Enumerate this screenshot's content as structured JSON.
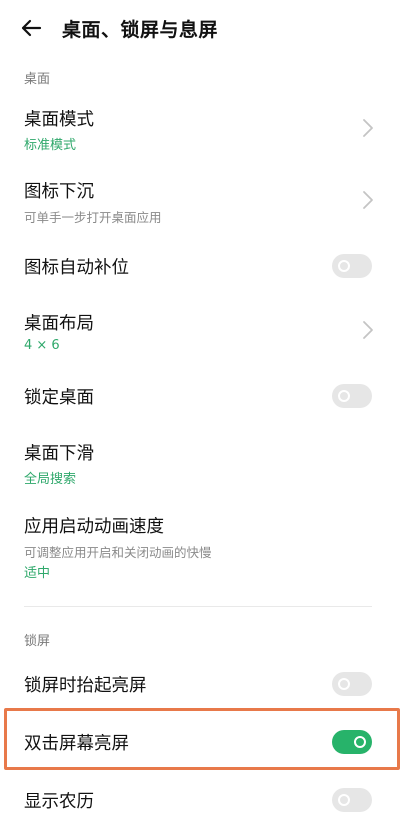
{
  "header": {
    "title": "桌面、锁屏与息屏"
  },
  "sections": {
    "desktop": "桌面",
    "lockscreen": "锁屏"
  },
  "items": {
    "desktop_mode": {
      "title": "桌面模式",
      "value": "标准模式"
    },
    "icon_sink": {
      "title": "图标下沉",
      "subtitle": "可单手一步打开桌面应用"
    },
    "icon_autofill": {
      "title": "图标自动补位",
      "enabled": false
    },
    "desktop_layout": {
      "title": "桌面布局",
      "value": "4 × 6"
    },
    "lock_desktop": {
      "title": "锁定桌面",
      "enabled": false
    },
    "desktop_swipe": {
      "title": "桌面下滑",
      "value": "全局搜索"
    },
    "anim_speed": {
      "title": "应用启动动画速度",
      "subtitle": "可调整应用开启和关闭动画的快慢",
      "value": "适中"
    },
    "raise_to_wake": {
      "title": "锁屏时抬起亮屏",
      "enabled": false
    },
    "double_tap_wake": {
      "title": "双击屏幕亮屏",
      "enabled": true
    },
    "lunar_calendar": {
      "title": "显示农历",
      "enabled": false
    }
  },
  "colors": {
    "accent": "#27b36a",
    "highlight": "#e8794a"
  }
}
